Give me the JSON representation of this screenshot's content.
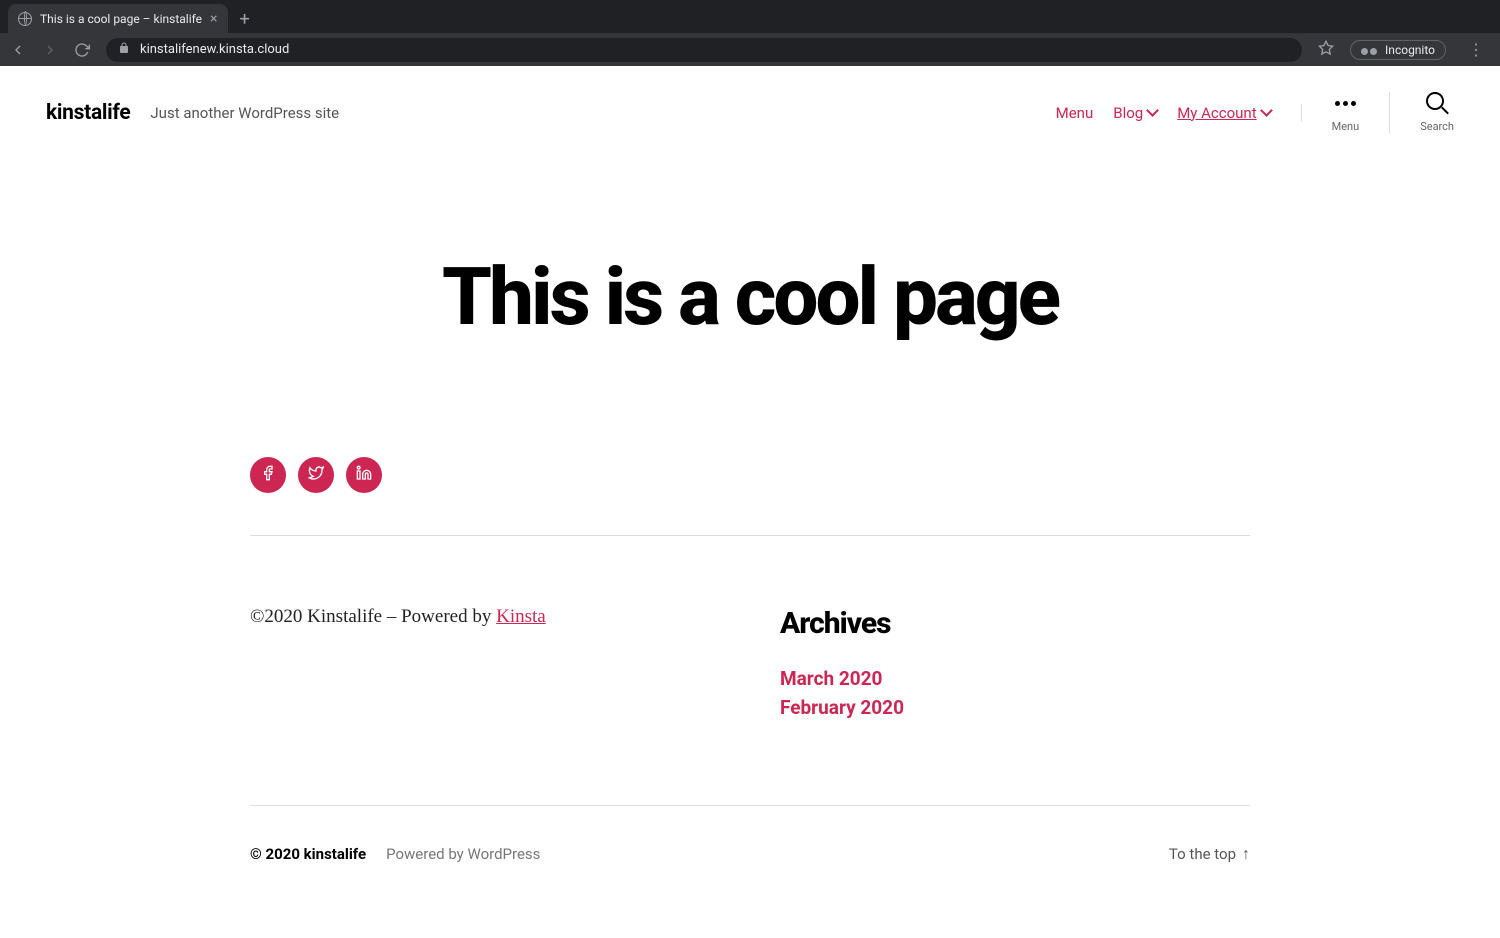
{
  "browser": {
    "tab_title": "This is a cool page – kinstalife",
    "url_display": "kinstalifenew.kinsta.cloud",
    "incognito_label": "Incognito"
  },
  "header": {
    "site_title": "kinstalife",
    "tagline": "Just another WordPress site",
    "nav": {
      "menu": "Menu",
      "blog": "Blog",
      "my_account": "My Account"
    },
    "menu_toggle_label": "Menu",
    "search_toggle_label": "Search"
  },
  "hero": {
    "title": "This is a cool page"
  },
  "social": {
    "facebook": "Facebook",
    "twitter": "Twitter",
    "linkedin": "LinkedIn"
  },
  "footer_widgets": {
    "copyright_prefix": "©2020 Kinstalife – Powered by ",
    "kinsta_link": "Kinsta",
    "archives_title": "Archives",
    "archives": [
      "March 2020",
      "February 2020"
    ]
  },
  "footer": {
    "copyright_year": "© 2020 ",
    "site_name": "kinstalife",
    "powered_by": "Powered by WordPress",
    "to_top": "To the top"
  },
  "colors": {
    "accent": "#cd2653"
  }
}
